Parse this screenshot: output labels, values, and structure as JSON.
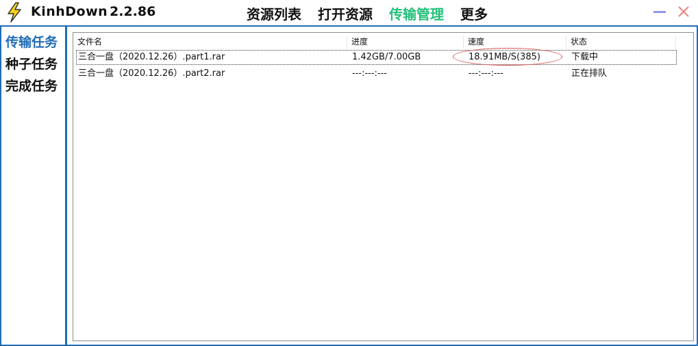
{
  "app": {
    "name": "KinhDown",
    "version": "2.2.86"
  },
  "nav": [
    {
      "label": "资源列表"
    },
    {
      "label": "打开资源"
    },
    {
      "label": "传输管理",
      "active": true
    },
    {
      "label": "更多"
    }
  ],
  "sidebar": {
    "items": [
      {
        "label": "传输任务",
        "active": true
      },
      {
        "label": "种子任务"
      },
      {
        "label": "完成任务"
      }
    ]
  },
  "table": {
    "columns": [
      "文件名",
      "进度",
      "速度",
      "状态"
    ],
    "rows": [
      {
        "name": "三合一盘（2020.12.26）.part1.rar",
        "progress": "1.42GB/7.00GB",
        "speed": "18.91MB/S(385)",
        "status": "下载中"
      },
      {
        "name": "三合一盘（2020.12.26）.part2.rar",
        "progress": "---:---:---",
        "speed": "---:---:---",
        "status": "正在排队"
      }
    ]
  },
  "colors": {
    "accent": "#1f6bb5",
    "active_nav": "#22c07a",
    "minimize": "#8f97e6",
    "close": "#f08080"
  },
  "icons": {
    "app": "lightning-bolt-icon",
    "minimize": "minimize-icon",
    "close": "close-icon"
  }
}
